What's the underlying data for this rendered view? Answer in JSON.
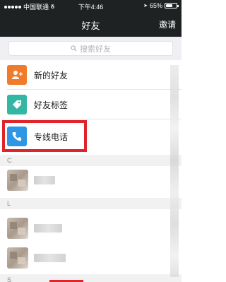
{
  "status_bar": {
    "carrier": "中国联通",
    "time": "下午4:46",
    "battery_percent_label": "65%",
    "battery_level": 0.65
  },
  "nav": {
    "title": "好友",
    "right_action": "邀请"
  },
  "search": {
    "placeholder": "搜索好友"
  },
  "menu": [
    {
      "label": "新的好友",
      "icon": "add-friend-icon",
      "color": "#f07b2a"
    },
    {
      "label": "好友标签",
      "icon": "tag-icon",
      "color": "#33b7a4"
    },
    {
      "label": "专线电话",
      "icon": "phone-icon",
      "color": "#2f96e6"
    }
  ],
  "sections": [
    {
      "letter": "C"
    },
    {
      "letter": "L"
    },
    {
      "letter": "S"
    }
  ],
  "colors": {
    "header_bg": "#1f2223",
    "highlight": "#e0242c"
  }
}
